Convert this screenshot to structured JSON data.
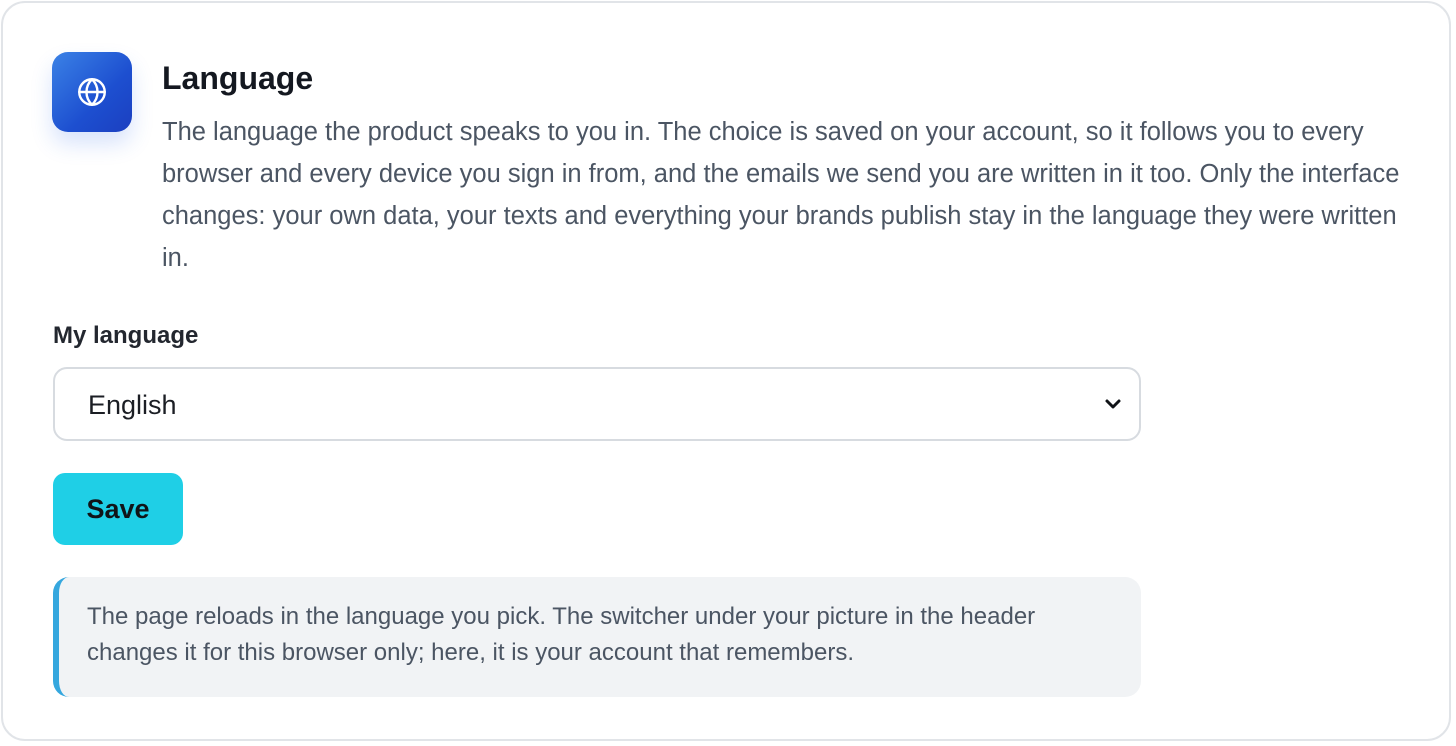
{
  "section": {
    "title": "Language",
    "description": "The language the product speaks to you in. The choice is saved on your account, so it follows you to every browser and every device you sign in from, and the emails we send you are written in it too. Only the interface changes: your own data, your texts and everything your brands publish stay in the language they were written in.",
    "icon": "globe-icon"
  },
  "form": {
    "language_label": "My language",
    "language_selected": "English",
    "save_label": "Save"
  },
  "note": {
    "text": "The page reloads in the language you pick. The switcher under your picture in the header changes it for this browser only; here, it is your account that remembers."
  },
  "colors": {
    "accent": "#1fcfe6",
    "icon_tile": "#2563eb",
    "note_border": "#35a7de",
    "note_bg": "#f1f3f5"
  }
}
